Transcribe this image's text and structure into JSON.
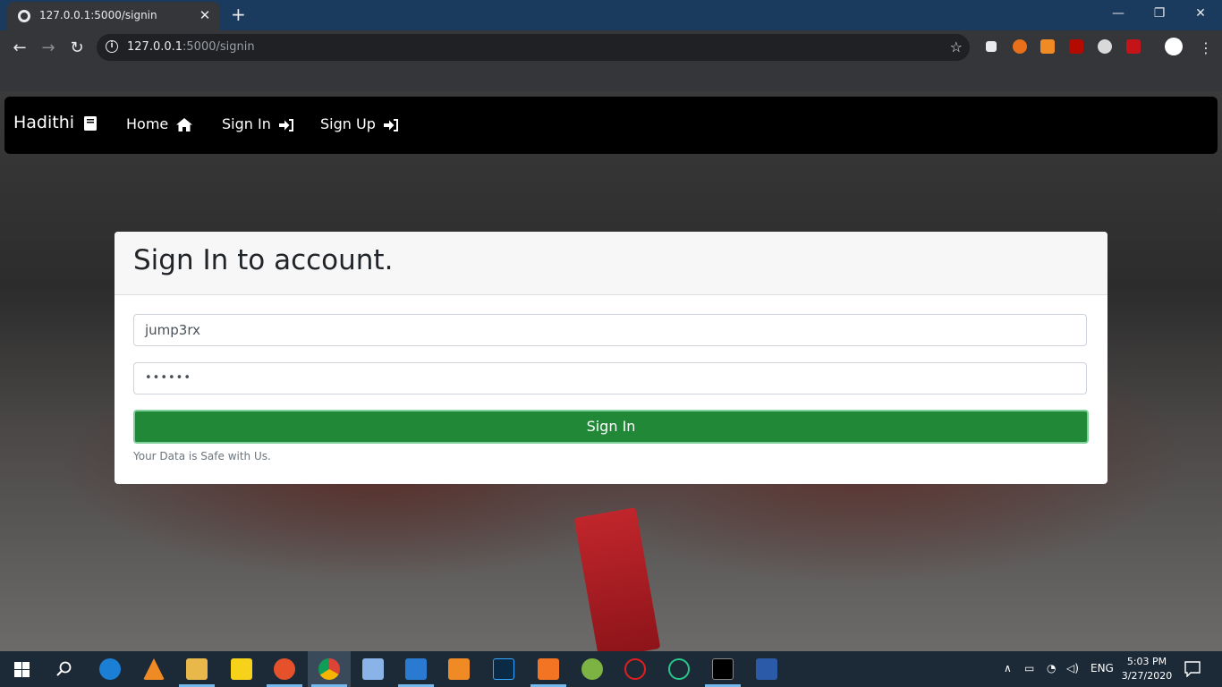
{
  "browser": {
    "tab_title": "127.0.0.1:5000/signin",
    "tab_close": "✕",
    "new_tab": "+",
    "window": {
      "minimize": "—",
      "restore": "❐",
      "close": "✕"
    },
    "url_host": "127.0.0.1",
    "url_path": ":5000/signin",
    "nav": {
      "back": "←",
      "forward": "→",
      "reload": "↻"
    },
    "bookmark_star": "☆"
  },
  "navbar": {
    "brand": "Hadithi",
    "links": [
      {
        "label": "Home"
      },
      {
        "label": "Sign In"
      },
      {
        "label": "Sign Up"
      }
    ]
  },
  "signin_card": {
    "title": "Sign In to account.",
    "username_value": "jump3rx",
    "password_value": "••••••",
    "submit_label": "Sign In",
    "help_text": "Your Data is Safe with Us.",
    "accent_color": "#218838"
  },
  "taskbar": {
    "language": "ENG",
    "time": "5:03 PM",
    "date": "3/27/2020"
  }
}
